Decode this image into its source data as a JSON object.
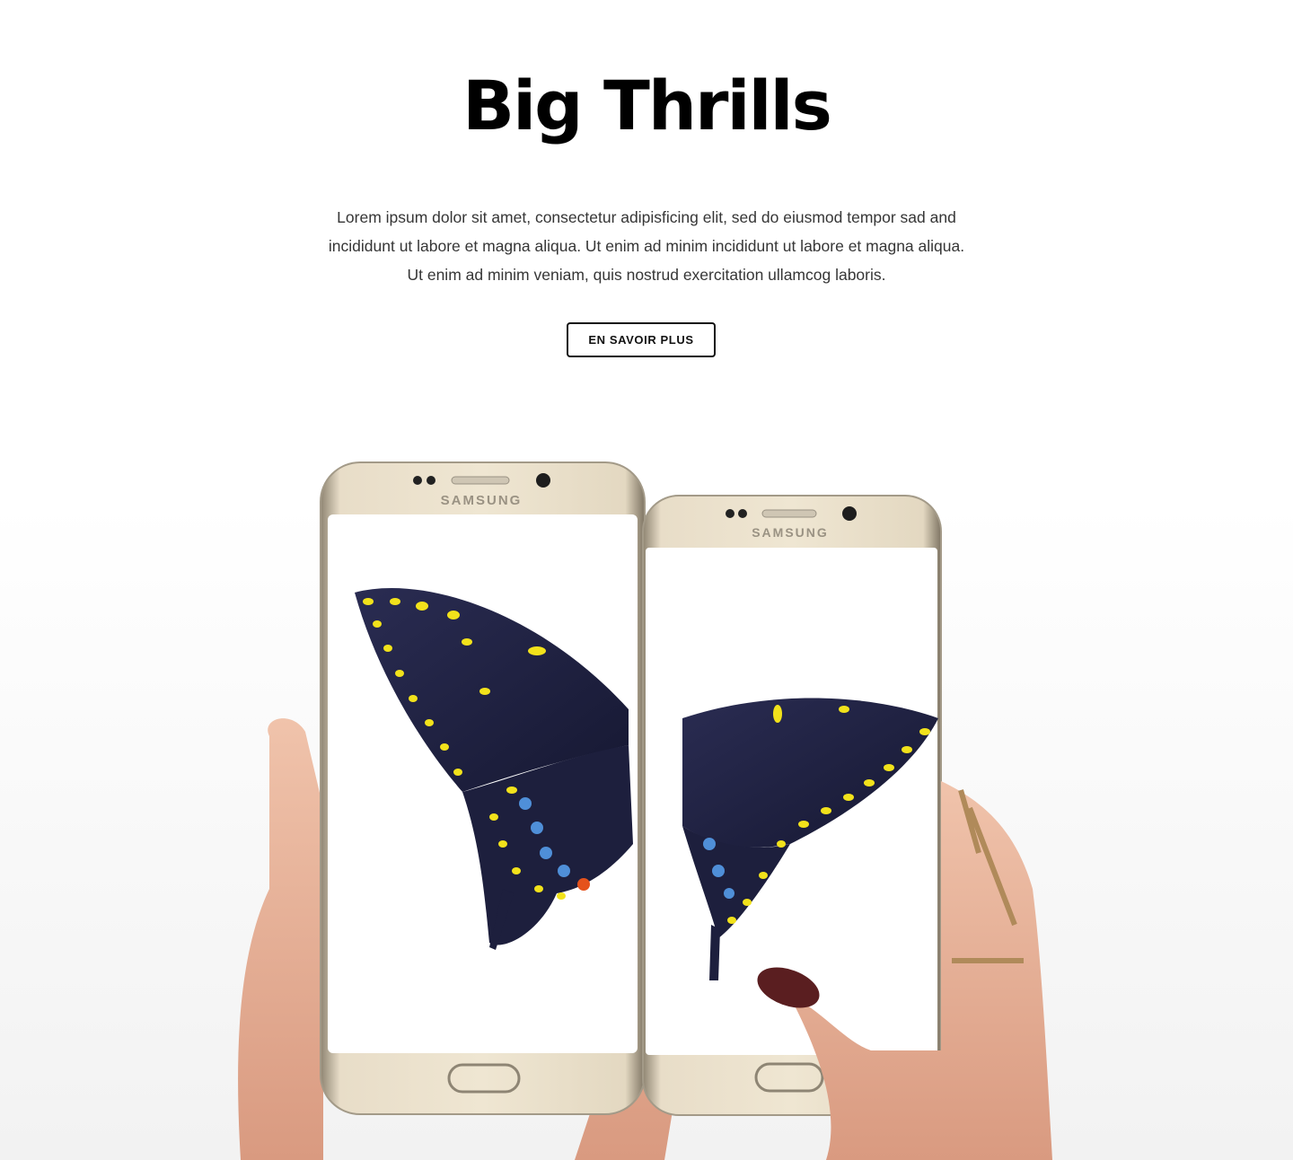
{
  "hero": {
    "title": "Big Thrills",
    "description": "Lorem ipsum dolor sit amet, consectetur adipisficing elit, sed do eiusmod tempor sad and incididunt ut labore et magna aliqua. Ut enim ad minim incididunt ut labore et magna aliqua. Ut enim ad minim veniam, quis nostrud exercitation ullamcog laboris.",
    "cta_label": "EN SAVOIR PLUS"
  },
  "illustration": {
    "left_phone_brand": "SAMSUNG",
    "right_phone_brand": "SAMSUNG"
  },
  "colors": {
    "phone_gold": "#d9cbb0",
    "phone_frame": "#b8ad98",
    "butterfly_wing": "#1f2240",
    "butterfly_spots": "#f2e21b",
    "butterfly_blue": "#4f8fd8",
    "skin": "#e8b39a",
    "nail": "#5a1e20"
  }
}
